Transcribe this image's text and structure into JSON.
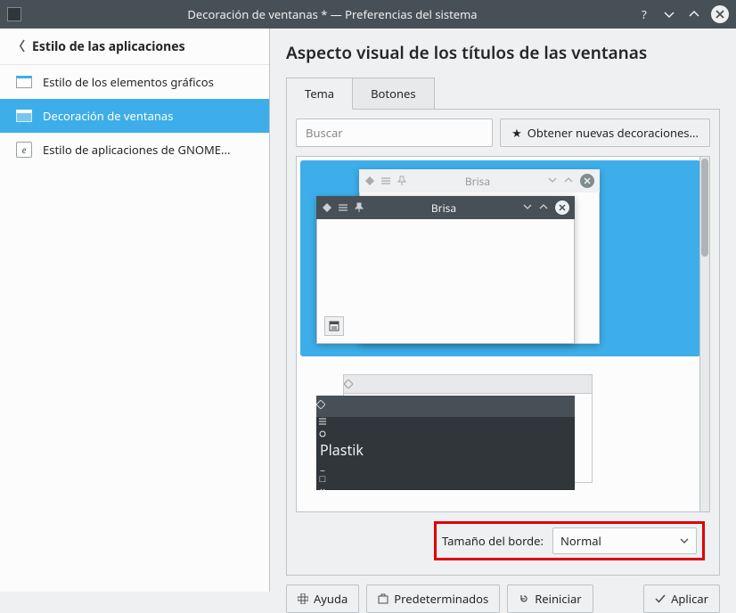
{
  "window": {
    "title": "Decoración de ventanas * — Preferencias del sistema"
  },
  "sidebar": {
    "header": "Estilo de las aplicaciones",
    "items": [
      {
        "label": "Estilo de los elementos gráficos"
      },
      {
        "label": "Decoración de ventanas"
      },
      {
        "label": "Estilo de aplicaciones de GNOME..."
      }
    ]
  },
  "main": {
    "heading": "Aspecto visual de los títulos de las ventanas",
    "tabs": {
      "theme": "Tema",
      "buttons": "Botones"
    },
    "search_placeholder": "Buscar",
    "get_new": "Obtener nuevas decoraciones...",
    "themes": {
      "brisa": "Brisa",
      "plastik": "Plastik"
    },
    "border": {
      "label": "Tamaño del borde:",
      "value": "Normal"
    }
  },
  "footer": {
    "help": "Ayuda",
    "defaults": "Predeterminados",
    "reset": "Reiniciar",
    "apply": "Aplicar"
  }
}
